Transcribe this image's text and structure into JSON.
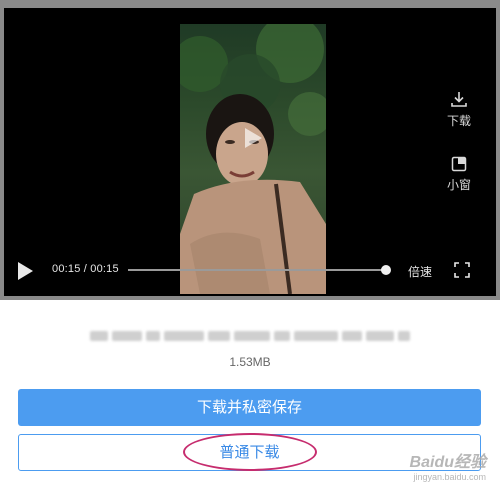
{
  "player": {
    "current_time": "00:15",
    "duration": "00:15",
    "time_display": "00:15 / 00:15",
    "progress_fraction": 1.0,
    "speed_label": "倍速",
    "side_actions": [
      {
        "icon": "download-icon",
        "label": "下载"
      },
      {
        "icon": "mini-window-icon",
        "label": "小窗"
      }
    ]
  },
  "file": {
    "size": "1.53MB"
  },
  "actions": {
    "primary_label": "下载并私密保存",
    "secondary_label": "普通下载"
  },
  "watermark": {
    "text": "Baidu经验",
    "sub": "jingyan.baidu.com"
  },
  "colors": {
    "primary_button": "#4c9cf0",
    "highlight_ring": "#c62c6e"
  }
}
